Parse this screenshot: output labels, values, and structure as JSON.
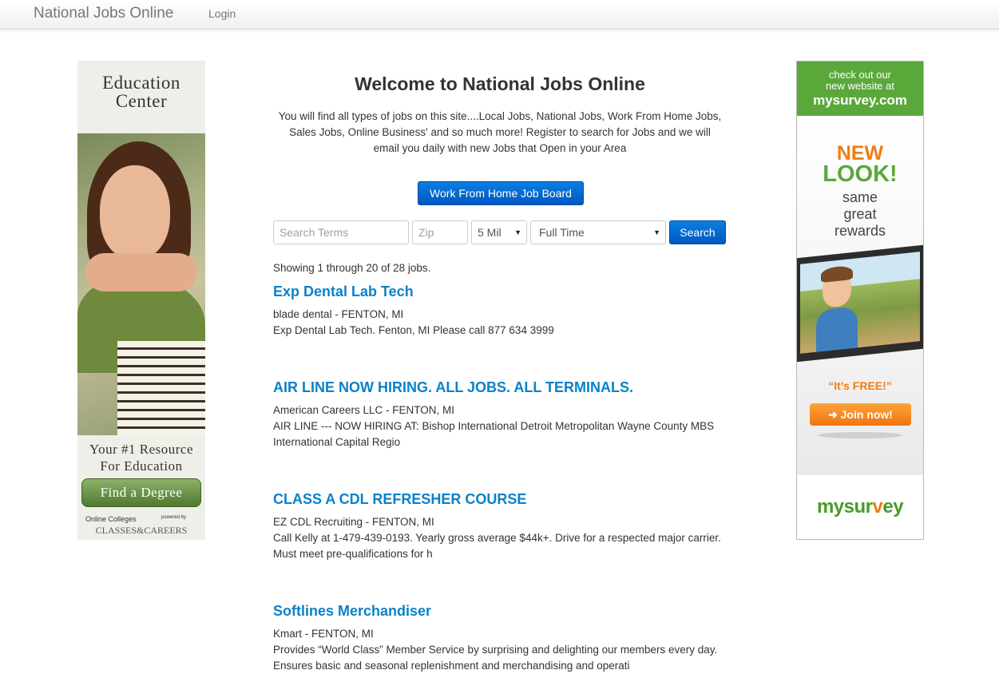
{
  "navbar": {
    "brand": "National Jobs Online",
    "login": "Login"
  },
  "left_ad": {
    "title_line1": "Education",
    "title_line2": "Center",
    "tagline_line1": "Your #1 Resource",
    "tagline_line2": "For Education",
    "button": "Find a Degree",
    "footer_a": "Online Colleges",
    "footer_b": "powered by",
    "footer_c": "CLASSES&CAREERS"
  },
  "right_ad": {
    "top_line1": "check out our",
    "top_line2": "new website at",
    "top_line3": "mysurvey.com",
    "new": "NEW",
    "look": "LOOK!",
    "same_line1": "same",
    "same_line2": "great",
    "same_line3": "rewards",
    "free": "“It’s FREE!”",
    "join": "➜ Join now!",
    "logo_part1": "mysur",
    "logo_part2": "v",
    "logo_part3": "ey"
  },
  "main": {
    "title": "Welcome to National Jobs Online",
    "intro": "You will find all types of jobs on this site....Local Jobs, National Jobs, Work From Home Jobs, Sales Jobs, Online Business' and so much more! Register to search for Jobs and we will email you daily with new Jobs that Open in your Area",
    "wfh_button": "Work From Home Job Board"
  },
  "search": {
    "terms_placeholder": "Search Terms",
    "zip_placeholder": "Zip",
    "miles_value": "5 Mil",
    "type_value": "Full Time",
    "button": "Search"
  },
  "results": {
    "summary": "Showing 1 through 20 of 28 jobs.",
    "jobs": [
      {
        "title": "Exp Dental Lab Tech",
        "company": "blade dental - FENTON, MI",
        "description": "Exp Dental Lab Tech. Fenton, MI  Please call 877 634 3999"
      },
      {
        "title": "AIR LINE NOW HIRING. ALL JOBS. ALL TERMINALS.",
        "company": "American Careers LLC - FENTON, MI",
        "description": "AIR LINE --- NOW HIRING AT:  Bishop International Detroit Metropolitan Wayne County MBS International Capital Regio"
      },
      {
        "title": "CLASS A CDL REFRESHER COURSE",
        "company": "EZ CDL Recruiting - FENTON, MI",
        "description": "Call Kelly at 1-479-439-0193. Yearly gross average $44k+. Drive for a respected major carrier. Must meet pre-qualifications for h"
      },
      {
        "title": "Softlines Merchandiser",
        "company": "Kmart - FENTON, MI",
        "description": "Provides “World Class” Member Service by surprising and delighting our members every day. Ensures basic and seasonal replenishment and merchandising and operati"
      }
    ]
  },
  "colors": {
    "job_link": "#0a82c8",
    "primary_button": "#0a6fd6",
    "mysurvey_green": "#5aa83a",
    "mysurvey_orange": "#f07d14"
  }
}
